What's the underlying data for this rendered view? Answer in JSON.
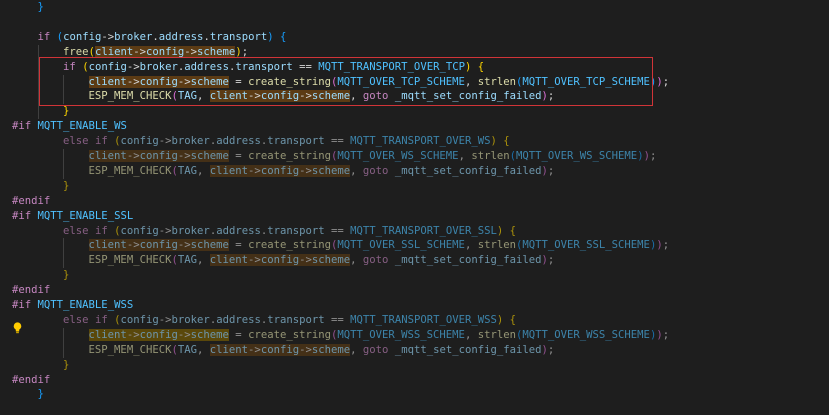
{
  "editor": {
    "lines": [
      {
        "id": "l0",
        "tokens": [
          [
            "",
            "    "
          ],
          [
            "br3",
            "}"
          ]
        ]
      },
      {
        "id": "l1",
        "tokens": []
      },
      {
        "id": "l2",
        "tokens": [
          [
            "",
            "    "
          ],
          [
            "kw",
            "if"
          ],
          [
            "",
            " "
          ],
          [
            "br3",
            "("
          ],
          [
            "var",
            "config"
          ],
          [
            "op",
            "->"
          ],
          [
            "var",
            "broker"
          ],
          [
            "op",
            "."
          ],
          [
            "var",
            "address"
          ],
          [
            "op",
            "."
          ],
          [
            "var",
            "transport"
          ],
          [
            "br3",
            ")"
          ],
          [
            "",
            " "
          ],
          [
            "br3",
            "{"
          ]
        ]
      },
      {
        "id": "l3",
        "tokens": [
          [
            "",
            "        "
          ],
          [
            "fn",
            "free"
          ],
          [
            "br1",
            "("
          ],
          [
            "hl:var",
            "client"
          ],
          [
            "hl:op",
            "->"
          ],
          [
            "hl:var",
            "config"
          ],
          [
            "hl:op",
            "->"
          ],
          [
            "hl:var",
            "scheme"
          ],
          [
            "br1",
            ")"
          ],
          [
            "op",
            ";"
          ]
        ]
      },
      {
        "id": "l4",
        "tokens": [
          [
            "",
            "        "
          ],
          [
            "kw",
            "if"
          ],
          [
            "",
            " "
          ],
          [
            "br1",
            "("
          ],
          [
            "var",
            "config"
          ],
          [
            "op",
            "->"
          ],
          [
            "var",
            "broker"
          ],
          [
            "op",
            "."
          ],
          [
            "var",
            "address"
          ],
          [
            "op",
            "."
          ],
          [
            "var",
            "transport"
          ],
          [
            "op",
            " == "
          ],
          [
            "mac",
            "MQTT_TRANSPORT_OVER_TCP"
          ],
          [
            "br1",
            ")"
          ],
          [
            "",
            " "
          ],
          [
            "br1",
            "{"
          ]
        ]
      },
      {
        "id": "l5",
        "tokens": [
          [
            "",
            "            "
          ],
          [
            "hl:var",
            "client"
          ],
          [
            "hl:op",
            "->"
          ],
          [
            "hl:var",
            "config"
          ],
          [
            "hl:op",
            "->"
          ],
          [
            "hl:var",
            "scheme"
          ],
          [
            "op",
            " = "
          ],
          [
            "fn",
            "create_string"
          ],
          [
            "br2",
            "("
          ],
          [
            "mac",
            "MQTT_OVER_TCP_SCHEME"
          ],
          [
            "op",
            ", "
          ],
          [
            "fn",
            "strlen"
          ],
          [
            "br3",
            "("
          ],
          [
            "mac",
            "MQTT_OVER_TCP_SCHEME"
          ],
          [
            "br3",
            ")"
          ],
          [
            "br2",
            ")"
          ],
          [
            "op",
            ";"
          ]
        ]
      },
      {
        "id": "l6",
        "tokens": [
          [
            "",
            "            "
          ],
          [
            "fn",
            "ESP_MEM_CHECK"
          ],
          [
            "br2",
            "("
          ],
          [
            "var",
            "TAG"
          ],
          [
            "op",
            ", "
          ],
          [
            "hl:var",
            "client"
          ],
          [
            "hl:op",
            "->"
          ],
          [
            "hl:var",
            "config"
          ],
          [
            "hl:op",
            "->"
          ],
          [
            "hl:var",
            "scheme"
          ],
          [
            "op",
            ", "
          ],
          [
            "kw",
            "goto"
          ],
          [
            "op",
            " "
          ],
          [
            "var",
            "_mqtt_set_config_failed"
          ],
          [
            "br2",
            ")"
          ],
          [
            "op",
            ";"
          ]
        ]
      },
      {
        "id": "l7",
        "tokens": [
          [
            "",
            "        "
          ],
          [
            "br1",
            "}"
          ]
        ]
      },
      {
        "id": "l8",
        "tokens": [
          [
            "pp",
            "#if"
          ],
          [
            "",
            " "
          ],
          [
            "mac",
            "MQTT_ENABLE_WS"
          ]
        ]
      },
      {
        "id": "l9",
        "inactive": true,
        "tokens": [
          [
            "",
            "        "
          ],
          [
            "kw",
            "else"
          ],
          [
            "",
            " "
          ],
          [
            "kw",
            "if"
          ],
          [
            "",
            " "
          ],
          [
            "br1",
            "("
          ],
          [
            "var",
            "config"
          ],
          [
            "op",
            "->"
          ],
          [
            "var",
            "broker"
          ],
          [
            "op",
            "."
          ],
          [
            "var",
            "address"
          ],
          [
            "op",
            "."
          ],
          [
            "var",
            "transport"
          ],
          [
            "op",
            " == "
          ],
          [
            "mac",
            "MQTT_TRANSPORT_OVER_WS"
          ],
          [
            "br1",
            ")"
          ],
          [
            "",
            " "
          ],
          [
            "br1",
            "{"
          ]
        ]
      },
      {
        "id": "l10",
        "inactive": true,
        "tokens": [
          [
            "",
            "            "
          ],
          [
            "hl:var",
            "client"
          ],
          [
            "hl:op",
            "->"
          ],
          [
            "hl:var",
            "config"
          ],
          [
            "hl:op",
            "->"
          ],
          [
            "hl:var",
            "scheme"
          ],
          [
            "op",
            " = "
          ],
          [
            "fn",
            "create_string"
          ],
          [
            "br2",
            "("
          ],
          [
            "mac",
            "MQTT_OVER_WS_SCHEME"
          ],
          [
            "op",
            ", "
          ],
          [
            "fn",
            "strlen"
          ],
          [
            "br3",
            "("
          ],
          [
            "mac",
            "MQTT_OVER_WS_SCHEME"
          ],
          [
            "br3",
            ")"
          ],
          [
            "br2",
            ")"
          ],
          [
            "op",
            ";"
          ]
        ]
      },
      {
        "id": "l11",
        "inactive": true,
        "tokens": [
          [
            "",
            "            "
          ],
          [
            "fn",
            "ESP_MEM_CHECK"
          ],
          [
            "br2",
            "("
          ],
          [
            "var",
            "TAG"
          ],
          [
            "op",
            ", "
          ],
          [
            "hl:var",
            "client"
          ],
          [
            "hl:op",
            "->"
          ],
          [
            "hl:var",
            "config"
          ],
          [
            "hl:op",
            "->"
          ],
          [
            "hl:var",
            "scheme"
          ],
          [
            "op",
            ", "
          ],
          [
            "kw",
            "goto"
          ],
          [
            "op",
            " "
          ],
          [
            "var",
            "_mqtt_set_config_failed"
          ],
          [
            "br2",
            ")"
          ],
          [
            "op",
            ";"
          ]
        ]
      },
      {
        "id": "l12",
        "inactive": true,
        "tokens": [
          [
            "",
            "        "
          ],
          [
            "br1",
            "}"
          ]
        ]
      },
      {
        "id": "l13",
        "tokens": [
          [
            "pp",
            "#endif"
          ]
        ]
      },
      {
        "id": "l14",
        "tokens": [
          [
            "pp",
            "#if"
          ],
          [
            "",
            " "
          ],
          [
            "mac",
            "MQTT_ENABLE_SSL"
          ]
        ]
      },
      {
        "id": "l15",
        "inactive": true,
        "tokens": [
          [
            "",
            "        "
          ],
          [
            "kw",
            "else"
          ],
          [
            "",
            " "
          ],
          [
            "kw",
            "if"
          ],
          [
            "",
            " "
          ],
          [
            "br1",
            "("
          ],
          [
            "var",
            "config"
          ],
          [
            "op",
            "->"
          ],
          [
            "var",
            "broker"
          ],
          [
            "op",
            "."
          ],
          [
            "var",
            "address"
          ],
          [
            "op",
            "."
          ],
          [
            "var",
            "transport"
          ],
          [
            "op",
            " == "
          ],
          [
            "mac",
            "MQTT_TRANSPORT_OVER_SSL"
          ],
          [
            "br1",
            ")"
          ],
          [
            "",
            " "
          ],
          [
            "br1",
            "{"
          ]
        ]
      },
      {
        "id": "l16",
        "inactive": true,
        "tokens": [
          [
            "",
            "            "
          ],
          [
            "hl:var",
            "client"
          ],
          [
            "hl:op",
            "->"
          ],
          [
            "hl:var",
            "config"
          ],
          [
            "hl:op",
            "->"
          ],
          [
            "hl:var",
            "scheme"
          ],
          [
            "op",
            " = "
          ],
          [
            "fn",
            "create_string"
          ],
          [
            "br2",
            "("
          ],
          [
            "mac",
            "MQTT_OVER_SSL_SCHEME"
          ],
          [
            "op",
            ", "
          ],
          [
            "fn",
            "strlen"
          ],
          [
            "br3",
            "("
          ],
          [
            "mac",
            "MQTT_OVER_SSL_SCHEME"
          ],
          [
            "br3",
            ")"
          ],
          [
            "br2",
            ")"
          ],
          [
            "op",
            ";"
          ]
        ]
      },
      {
        "id": "l17",
        "inactive": true,
        "tokens": [
          [
            "",
            "            "
          ],
          [
            "fn",
            "ESP_MEM_CHECK"
          ],
          [
            "br2",
            "("
          ],
          [
            "var",
            "TAG"
          ],
          [
            "op",
            ", "
          ],
          [
            "hl:var",
            "client"
          ],
          [
            "hl:op",
            "->"
          ],
          [
            "hl:var",
            "config"
          ],
          [
            "hl:op",
            "->"
          ],
          [
            "hl:var",
            "scheme"
          ],
          [
            "op",
            ", "
          ],
          [
            "kw",
            "goto"
          ],
          [
            "op",
            " "
          ],
          [
            "var",
            "_mqtt_set_config_failed"
          ],
          [
            "br2",
            ")"
          ],
          [
            "op",
            ";"
          ]
        ]
      },
      {
        "id": "l18",
        "inactive": true,
        "tokens": [
          [
            "",
            "        "
          ],
          [
            "br1",
            "}"
          ]
        ]
      },
      {
        "id": "l19",
        "tokens": [
          [
            "pp",
            "#endif"
          ]
        ]
      },
      {
        "id": "l20",
        "tokens": [
          [
            "pp",
            "#if"
          ],
          [
            "",
            " "
          ],
          [
            "mac",
            "MQTT_ENABLE_WSS"
          ]
        ]
      },
      {
        "id": "l21",
        "inactive": true,
        "tokens": [
          [
            "",
            "        "
          ],
          [
            "kw",
            "else"
          ],
          [
            "",
            " "
          ],
          [
            "kw",
            "if"
          ],
          [
            "",
            " "
          ],
          [
            "br1",
            "("
          ],
          [
            "var",
            "config"
          ],
          [
            "op",
            "->"
          ],
          [
            "var",
            "broker"
          ],
          [
            "op",
            "."
          ],
          [
            "var",
            "address"
          ],
          [
            "op",
            "."
          ],
          [
            "var",
            "transport"
          ],
          [
            "op",
            " == "
          ],
          [
            "mac",
            "MQTT_TRANSPORT_OVER_WSS"
          ],
          [
            "br1",
            ")"
          ],
          [
            "",
            " "
          ],
          [
            "br1",
            "{"
          ]
        ]
      },
      {
        "id": "l22",
        "inactive": true,
        "tokens": [
          [
            "",
            "            "
          ],
          [
            "hlw:var",
            "client"
          ],
          [
            "hlw:op",
            "->"
          ],
          [
            "hlw:var",
            "config"
          ],
          [
            "hlw:op",
            "->"
          ],
          [
            "hlw:var",
            "scheme"
          ],
          [
            "op",
            " = "
          ],
          [
            "fn",
            "create_string"
          ],
          [
            "br2",
            "("
          ],
          [
            "mac",
            "MQTT_OVER_WSS_SCHEME"
          ],
          [
            "op",
            ", "
          ],
          [
            "fn",
            "strlen"
          ],
          [
            "br3",
            "("
          ],
          [
            "mac",
            "MQTT_OVER_WSS_SCHEME"
          ],
          [
            "br3",
            ")"
          ],
          [
            "br2",
            ")"
          ],
          [
            "op",
            ";"
          ]
        ]
      },
      {
        "id": "l23",
        "inactive": true,
        "tokens": [
          [
            "",
            "            "
          ],
          [
            "fn",
            "ESP_MEM_CHECK"
          ],
          [
            "br2",
            "("
          ],
          [
            "var",
            "TAG"
          ],
          [
            "op",
            ", "
          ],
          [
            "hl:var",
            "client"
          ],
          [
            "hl:op",
            "->"
          ],
          [
            "hl:var",
            "config"
          ],
          [
            "hl:op",
            "->"
          ],
          [
            "hl:var",
            "scheme"
          ],
          [
            "op",
            ", "
          ],
          [
            "kw",
            "goto"
          ],
          [
            "op",
            " "
          ],
          [
            "var",
            "_mqtt_set_config_failed"
          ],
          [
            "br2",
            ")"
          ],
          [
            "op",
            ";"
          ]
        ]
      },
      {
        "id": "l24",
        "inactive": true,
        "tokens": [
          [
            "",
            "        "
          ],
          [
            "br1",
            "}"
          ]
        ]
      },
      {
        "id": "l25",
        "tokens": [
          [
            "pp",
            "#endif"
          ]
        ]
      },
      {
        "id": "l26",
        "tokens": [
          [
            "",
            "    "
          ],
          [
            "br3",
            "}"
          ]
        ]
      }
    ],
    "lightbulb_icon": "lightbulb-icon",
    "highlight_color": "#5c3b14",
    "selection_border_color": "#d13438"
  }
}
